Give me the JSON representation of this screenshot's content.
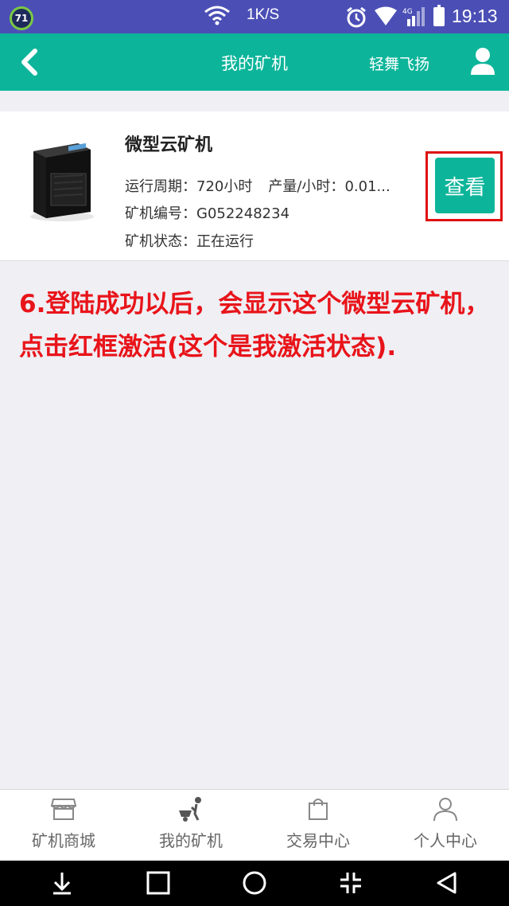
{
  "status_bar": {
    "badge": "71",
    "speed": "1K/S",
    "network": "4G",
    "time": "19:13"
  },
  "header": {
    "title": "我的矿机",
    "username": "轻舞飞扬"
  },
  "miner_card": {
    "name": "微型云矿机",
    "period_label": "运行周期：",
    "period_value": "720小时",
    "output_label": "产量/小时：",
    "output_value": "0.01...",
    "code_label": "矿机编号：",
    "code_value": "G052248234",
    "status_label": "矿机状态：",
    "status_value": "正在运行",
    "view_button": "查看"
  },
  "annotation": {
    "text": "6.登陆成功以后，会显示这个微型云矿机，点击红框激活(这个是我激活状态)."
  },
  "tabs": [
    {
      "label": "矿机商城",
      "icon": "store-icon"
    },
    {
      "label": "我的矿机",
      "icon": "miner-cart-icon"
    },
    {
      "label": "交易中心",
      "icon": "shopping-bag-icon"
    },
    {
      "label": "个人中心",
      "icon": "person-icon"
    }
  ],
  "colors": {
    "accent": "#0cb59a",
    "status_bar": "#4b4fb5",
    "annotation_red": "#e8141a"
  }
}
